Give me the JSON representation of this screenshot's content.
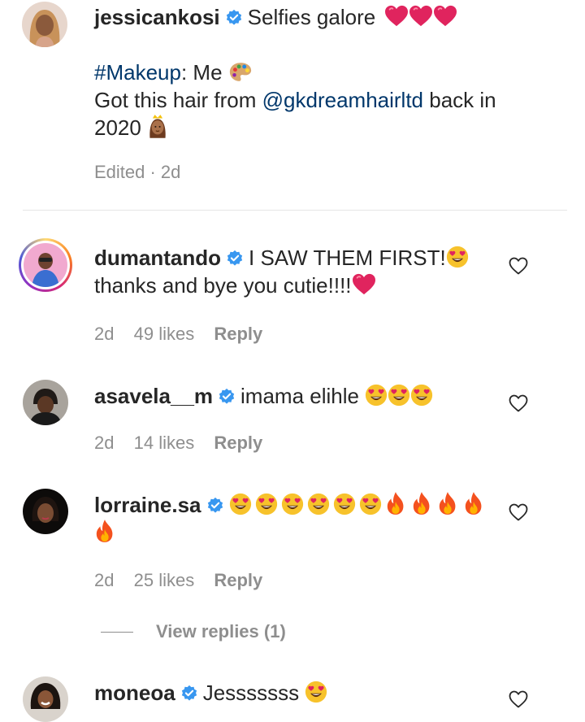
{
  "caption": {
    "username": "jessicankosi",
    "line1_text": "Selfies galore",
    "line1_emoji": [
      "heart",
      "heart",
      "heart"
    ],
    "makeup_tag": "#Makeup",
    "makeup_rest": ": Me",
    "hair_text": "Got this hair from",
    "hair_mention": "@gkdreamhairltd",
    "hair_suffix": "back in",
    "year": "2020",
    "edited": "Edited · 2d"
  },
  "comments": [
    {
      "username": "dumantando",
      "text_line1": "I SAW THEM FIRST!",
      "text_line2": "thanks and bye you cutie!!!!",
      "time": "2d",
      "likes": "49 likes",
      "reply": "Reply"
    },
    {
      "username": "asavela__m",
      "text_line1": "imama elihle",
      "time": "2d",
      "likes": "14 likes",
      "reply": "Reply"
    },
    {
      "username": "lorraine.sa",
      "time": "2d",
      "likes": "25 likes",
      "reply": "Reply",
      "view_replies": "View replies (1)"
    },
    {
      "username": "moneoa",
      "text_line1": "Jesssssss"
    }
  ],
  "icons": {
    "verified": "verified-badge-icon",
    "like": "heart-outline-icon",
    "emoji_heart": "red-heart",
    "emoji_heart_eyes": "smiling-face-with-heart-eyes",
    "emoji_fire": "fire",
    "emoji_palette": "artist-palette",
    "emoji_princess": "princess"
  },
  "colors": {
    "verified": "#3897f0",
    "mention": "#00376b",
    "muted": "#8e8e8e",
    "heart": "#e0245e"
  }
}
